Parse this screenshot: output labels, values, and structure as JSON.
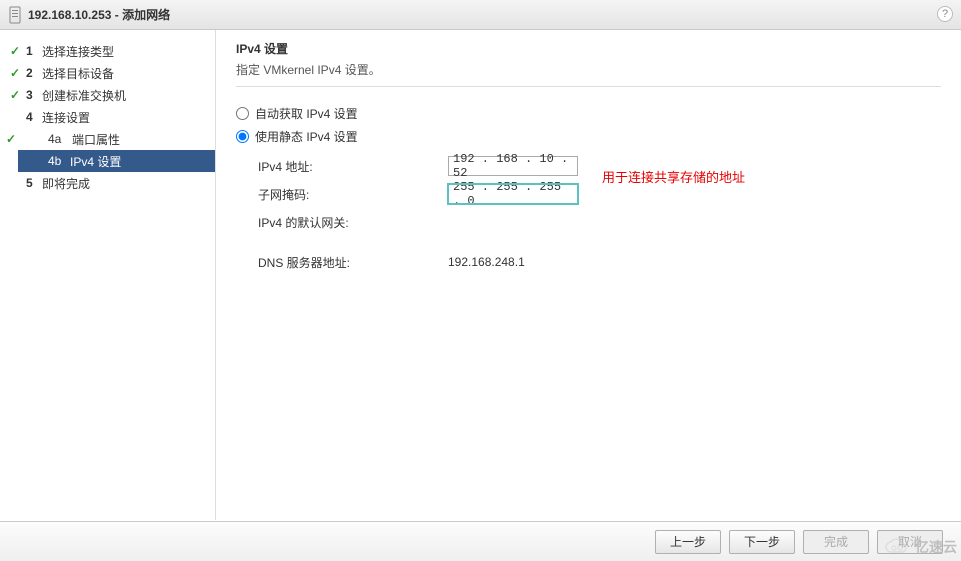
{
  "title": {
    "host": "192.168.10.253",
    "suffix": "添加网络"
  },
  "steps": [
    {
      "num": "1",
      "label": "选择连接类型",
      "done": true
    },
    {
      "num": "2",
      "label": "选择目标设备",
      "done": true
    },
    {
      "num": "3",
      "label": "创建标准交换机",
      "done": true
    },
    {
      "num": "4",
      "label": "连接设置",
      "done": false,
      "sub": [
        {
          "num": "4a",
          "label": "端口属性",
          "done": true,
          "selected": false
        },
        {
          "num": "4b",
          "label": "IPv4 设置",
          "done": false,
          "selected": true
        }
      ]
    },
    {
      "num": "5",
      "label": "即将完成",
      "done": false
    }
  ],
  "content": {
    "heading": "IPv4 设置",
    "subheading": "指定 VMkernel IPv4 设置。",
    "radio_auto": "自动获取 IPv4 设置",
    "radio_static": "使用静态 IPv4 设置",
    "selected_radio": "static",
    "fields": {
      "ipv4_addr_label": "IPv4 地址:",
      "ipv4_addr_value": "192 . 168 .  10 .  52",
      "subnet_label": "子网掩码:",
      "subnet_value": "255 . 255 . 255 .   0",
      "gateway_label": "IPv4 的默认网关:",
      "gateway_value": "",
      "dns_label": "DNS 服务器地址:",
      "dns_value": "192.168.248.1"
    },
    "annotation": "用于连接共享存储的地址"
  },
  "footer": {
    "back": "上一步",
    "next": "下一步",
    "finish": "完成",
    "cancel": "取消"
  },
  "watermark": "亿速云"
}
